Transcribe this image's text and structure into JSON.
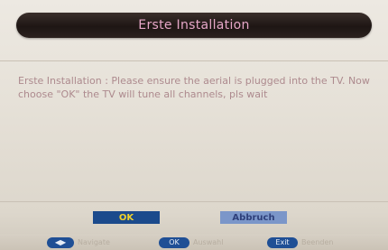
{
  "dialog": {
    "title": "Erste Installation",
    "message": "Erste Installation : Please ensure the aerial is plugged into the TV. Now choose \"OK\" the TV will tune all channels, pls wait"
  },
  "buttons": {
    "ok_label": "OK",
    "abort_label": "Abbruch"
  },
  "hints": [
    {
      "key": "◀▶",
      "key_icon": "left-right-arrows-icon",
      "label": "Navigate"
    },
    {
      "key": "OK",
      "key_icon": "ok-key-icon",
      "label": "Auswahl"
    },
    {
      "key": "Exit",
      "key_icon": "exit-key-icon",
      "label": "Beenden"
    }
  ],
  "colors": {
    "title_bar": "#1e1614",
    "title_text": "#e6a7c8",
    "message_text": "#ad8a8e",
    "ok_button_bg": "#1b4a8c",
    "ok_button_text": "#f2d22a",
    "abort_button_bg": "#7b96c9",
    "abort_button_text": "#2e3f7a",
    "hint_key_bg": "#1f4f95"
  }
}
